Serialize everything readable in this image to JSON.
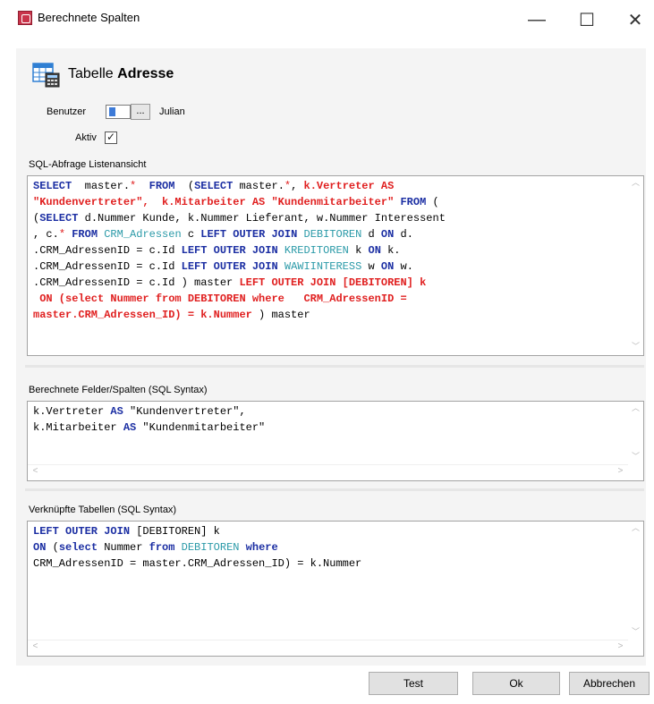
{
  "window": {
    "title": "Berechnete Spalten",
    "controls": {
      "minimize": "—",
      "maximize": "☐",
      "close": "✕"
    }
  },
  "header": {
    "table_label": "Tabelle",
    "table_name": "Adresse"
  },
  "user": {
    "label": "Benutzer",
    "browse_label": "...",
    "value": "Julian"
  },
  "active": {
    "label": "Aktiv",
    "checked": true,
    "checkmark": "✓"
  },
  "sql_query": {
    "label": "SQL-Abfrage Listenansicht",
    "lines": [
      [
        {
          "t": "SELECT",
          "c": "kw"
        },
        {
          "t": "  master.",
          "c": "n"
        },
        {
          "t": "*",
          "c": "rd2"
        },
        {
          "t": "  ",
          "c": "n"
        },
        {
          "t": "FROM",
          "c": "kw"
        },
        {
          "t": "  (",
          "c": "n"
        },
        {
          "t": "SELECT",
          "c": "kw"
        },
        {
          "t": " master.",
          "c": "n"
        },
        {
          "t": "*",
          "c": "rd2"
        },
        {
          "t": ", ",
          "c": "n"
        },
        {
          "t": "k.Vertreter AS",
          "c": "rd"
        }
      ],
      [
        {
          "t": "\"Kundenvertreter\",  k.Mitarbeiter AS \"Kundenmitarbeiter\"",
          "c": "rd"
        },
        {
          "t": " ",
          "c": "n"
        },
        {
          "t": "FROM",
          "c": "kw"
        },
        {
          "t": " (",
          "c": "n"
        }
      ],
      [
        {
          "t": "(",
          "c": "n"
        },
        {
          "t": "SELECT",
          "c": "kw"
        },
        {
          "t": " d.Nummer Kunde, k.Nummer Lieferant, w.Nummer Interessent",
          "c": "n"
        }
      ],
      [
        {
          "t": ", c.",
          "c": "n"
        },
        {
          "t": "*",
          "c": "rd2"
        },
        {
          "t": " ",
          "c": "n"
        },
        {
          "t": "FROM",
          "c": "kw"
        },
        {
          "t": " ",
          "c": "n"
        },
        {
          "t": "CRM_Adressen",
          "c": "tb"
        },
        {
          "t": " c ",
          "c": "n"
        },
        {
          "t": "LEFT OUTER JOIN",
          "c": "kw"
        },
        {
          "t": " ",
          "c": "n"
        },
        {
          "t": "DEBITOREN",
          "c": "tb"
        },
        {
          "t": " d ",
          "c": "n"
        },
        {
          "t": "ON",
          "c": "kw"
        },
        {
          "t": " d.",
          "c": "n"
        }
      ],
      [
        {
          "t": ".CRM_AdressenID = c.Id ",
          "c": "n"
        },
        {
          "t": "LEFT OUTER JOIN",
          "c": "kw"
        },
        {
          "t": " ",
          "c": "n"
        },
        {
          "t": "KREDITOREN",
          "c": "tb"
        },
        {
          "t": " k ",
          "c": "n"
        },
        {
          "t": "ON",
          "c": "kw"
        },
        {
          "t": " k.",
          "c": "n"
        }
      ],
      [
        {
          "t": ".CRM_AdressenID = c.Id ",
          "c": "n"
        },
        {
          "t": "LEFT OUTER JOIN",
          "c": "kw"
        },
        {
          "t": " ",
          "c": "n"
        },
        {
          "t": "WAWIINTERESS",
          "c": "tb"
        },
        {
          "t": " w ",
          "c": "n"
        },
        {
          "t": "ON",
          "c": "kw"
        },
        {
          "t": " w.",
          "c": "n"
        }
      ],
      [
        {
          "t": ".CRM_AdressenID = c.Id ) master ",
          "c": "n"
        },
        {
          "t": "LEFT OUTER JOIN [DEBITOREN] k",
          "c": "rd"
        }
      ],
      [
        {
          "t": " ON (select Nummer from DEBITOREN where   CRM_AdressenID =",
          "c": "rd"
        }
      ],
      [
        {
          "t": "master.CRM_Adressen_ID) = k.Nummer",
          "c": "rd"
        },
        {
          "t": " ) master",
          "c": "n"
        }
      ]
    ]
  },
  "computed_fields": {
    "label": "Berechnete Felder/Spalten (SQL Syntax)",
    "lines": [
      [
        {
          "t": "k.Vertreter ",
          "c": "n"
        },
        {
          "t": "AS",
          "c": "kw"
        },
        {
          "t": " \"Kundenvertreter\",",
          "c": "n"
        }
      ],
      [
        {
          "t": "k.Mitarbeiter ",
          "c": "n"
        },
        {
          "t": "AS",
          "c": "kw"
        },
        {
          "t": " \"Kundenmitarbeiter\"",
          "c": "n"
        }
      ]
    ]
  },
  "joined_tables": {
    "label": "Verknüpfte Tabellen (SQL Syntax)",
    "lines": [
      [
        {
          "t": "LEFT OUTER JOIN",
          "c": "kw"
        },
        {
          "t": " [DEBITOREN] k",
          "c": "n"
        }
      ],
      [
        {
          "t": "ON",
          "c": "kw"
        },
        {
          "t": " (",
          "c": "n"
        },
        {
          "t": "select",
          "c": "kw"
        },
        {
          "t": " Nummer ",
          "c": "n"
        },
        {
          "t": "from",
          "c": "kw"
        },
        {
          "t": " ",
          "c": "n"
        },
        {
          "t": "DEBITOREN",
          "c": "tb"
        },
        {
          "t": " ",
          "c": "n"
        },
        {
          "t": "where",
          "c": "kw"
        }
      ],
      [
        {
          "t": "CRM_AdressenID = master.CRM_Adressen_ID) = k.Nummer",
          "c": "n"
        }
      ]
    ]
  },
  "scroll_glyphs": {
    "up": "︿",
    "down": "﹀",
    "left": "<",
    "right": ">"
  },
  "buttons": {
    "test": "Test",
    "ok": "Ok",
    "cancel": "Abbrechen"
  },
  "colors": {
    "keyword": "#1c2fa3",
    "table": "#2b9aa8",
    "highlight": "#e02020"
  }
}
